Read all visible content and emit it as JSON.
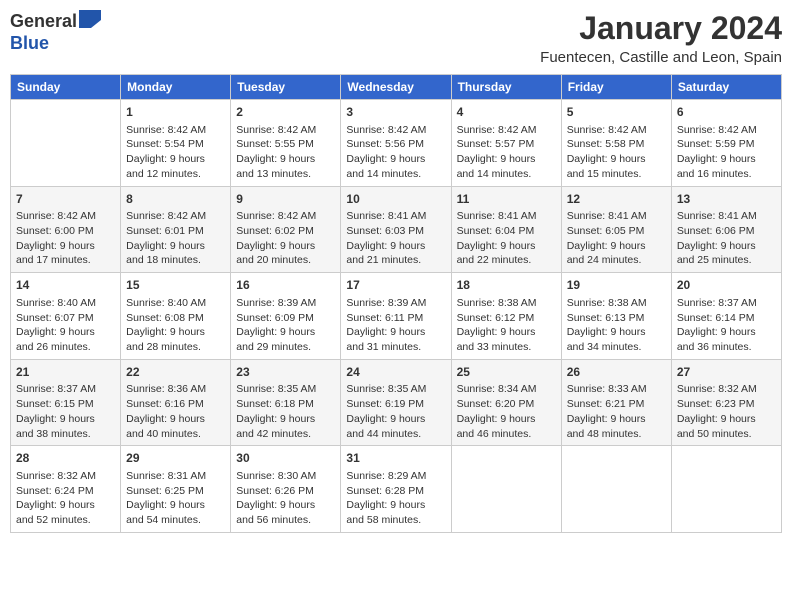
{
  "header": {
    "logo_general": "General",
    "logo_blue": "Blue",
    "month": "January 2024",
    "location": "Fuentecen, Castille and Leon, Spain"
  },
  "weekdays": [
    "Sunday",
    "Monday",
    "Tuesday",
    "Wednesday",
    "Thursday",
    "Friday",
    "Saturday"
  ],
  "weeks": [
    [
      {
        "day": "",
        "lines": []
      },
      {
        "day": "1",
        "lines": [
          "Sunrise: 8:42 AM",
          "Sunset: 5:54 PM",
          "Daylight: 9 hours",
          "and 12 minutes."
        ]
      },
      {
        "day": "2",
        "lines": [
          "Sunrise: 8:42 AM",
          "Sunset: 5:55 PM",
          "Daylight: 9 hours",
          "and 13 minutes."
        ]
      },
      {
        "day": "3",
        "lines": [
          "Sunrise: 8:42 AM",
          "Sunset: 5:56 PM",
          "Daylight: 9 hours",
          "and 14 minutes."
        ]
      },
      {
        "day": "4",
        "lines": [
          "Sunrise: 8:42 AM",
          "Sunset: 5:57 PM",
          "Daylight: 9 hours",
          "and 14 minutes."
        ]
      },
      {
        "day": "5",
        "lines": [
          "Sunrise: 8:42 AM",
          "Sunset: 5:58 PM",
          "Daylight: 9 hours",
          "and 15 minutes."
        ]
      },
      {
        "day": "6",
        "lines": [
          "Sunrise: 8:42 AM",
          "Sunset: 5:59 PM",
          "Daylight: 9 hours",
          "and 16 minutes."
        ]
      }
    ],
    [
      {
        "day": "7",
        "lines": [
          "Sunrise: 8:42 AM",
          "Sunset: 6:00 PM",
          "Daylight: 9 hours",
          "and 17 minutes."
        ]
      },
      {
        "day": "8",
        "lines": [
          "Sunrise: 8:42 AM",
          "Sunset: 6:01 PM",
          "Daylight: 9 hours",
          "and 18 minutes."
        ]
      },
      {
        "day": "9",
        "lines": [
          "Sunrise: 8:42 AM",
          "Sunset: 6:02 PM",
          "Daylight: 9 hours",
          "and 20 minutes."
        ]
      },
      {
        "day": "10",
        "lines": [
          "Sunrise: 8:41 AM",
          "Sunset: 6:03 PM",
          "Daylight: 9 hours",
          "and 21 minutes."
        ]
      },
      {
        "day": "11",
        "lines": [
          "Sunrise: 8:41 AM",
          "Sunset: 6:04 PM",
          "Daylight: 9 hours",
          "and 22 minutes."
        ]
      },
      {
        "day": "12",
        "lines": [
          "Sunrise: 8:41 AM",
          "Sunset: 6:05 PM",
          "Daylight: 9 hours",
          "and 24 minutes."
        ]
      },
      {
        "day": "13",
        "lines": [
          "Sunrise: 8:41 AM",
          "Sunset: 6:06 PM",
          "Daylight: 9 hours",
          "and 25 minutes."
        ]
      }
    ],
    [
      {
        "day": "14",
        "lines": [
          "Sunrise: 8:40 AM",
          "Sunset: 6:07 PM",
          "Daylight: 9 hours",
          "and 26 minutes."
        ]
      },
      {
        "day": "15",
        "lines": [
          "Sunrise: 8:40 AM",
          "Sunset: 6:08 PM",
          "Daylight: 9 hours",
          "and 28 minutes."
        ]
      },
      {
        "day": "16",
        "lines": [
          "Sunrise: 8:39 AM",
          "Sunset: 6:09 PM",
          "Daylight: 9 hours",
          "and 29 minutes."
        ]
      },
      {
        "day": "17",
        "lines": [
          "Sunrise: 8:39 AM",
          "Sunset: 6:11 PM",
          "Daylight: 9 hours",
          "and 31 minutes."
        ]
      },
      {
        "day": "18",
        "lines": [
          "Sunrise: 8:38 AM",
          "Sunset: 6:12 PM",
          "Daylight: 9 hours",
          "and 33 minutes."
        ]
      },
      {
        "day": "19",
        "lines": [
          "Sunrise: 8:38 AM",
          "Sunset: 6:13 PM",
          "Daylight: 9 hours",
          "and 34 minutes."
        ]
      },
      {
        "day": "20",
        "lines": [
          "Sunrise: 8:37 AM",
          "Sunset: 6:14 PM",
          "Daylight: 9 hours",
          "and 36 minutes."
        ]
      }
    ],
    [
      {
        "day": "21",
        "lines": [
          "Sunrise: 8:37 AM",
          "Sunset: 6:15 PM",
          "Daylight: 9 hours",
          "and 38 minutes."
        ]
      },
      {
        "day": "22",
        "lines": [
          "Sunrise: 8:36 AM",
          "Sunset: 6:16 PM",
          "Daylight: 9 hours",
          "and 40 minutes."
        ]
      },
      {
        "day": "23",
        "lines": [
          "Sunrise: 8:35 AM",
          "Sunset: 6:18 PM",
          "Daylight: 9 hours",
          "and 42 minutes."
        ]
      },
      {
        "day": "24",
        "lines": [
          "Sunrise: 8:35 AM",
          "Sunset: 6:19 PM",
          "Daylight: 9 hours",
          "and 44 minutes."
        ]
      },
      {
        "day": "25",
        "lines": [
          "Sunrise: 8:34 AM",
          "Sunset: 6:20 PM",
          "Daylight: 9 hours",
          "and 46 minutes."
        ]
      },
      {
        "day": "26",
        "lines": [
          "Sunrise: 8:33 AM",
          "Sunset: 6:21 PM",
          "Daylight: 9 hours",
          "and 48 minutes."
        ]
      },
      {
        "day": "27",
        "lines": [
          "Sunrise: 8:32 AM",
          "Sunset: 6:23 PM",
          "Daylight: 9 hours",
          "and 50 minutes."
        ]
      }
    ],
    [
      {
        "day": "28",
        "lines": [
          "Sunrise: 8:32 AM",
          "Sunset: 6:24 PM",
          "Daylight: 9 hours",
          "and 52 minutes."
        ]
      },
      {
        "day": "29",
        "lines": [
          "Sunrise: 8:31 AM",
          "Sunset: 6:25 PM",
          "Daylight: 9 hours",
          "and 54 minutes."
        ]
      },
      {
        "day": "30",
        "lines": [
          "Sunrise: 8:30 AM",
          "Sunset: 6:26 PM",
          "Daylight: 9 hours",
          "and 56 minutes."
        ]
      },
      {
        "day": "31",
        "lines": [
          "Sunrise: 8:29 AM",
          "Sunset: 6:28 PM",
          "Daylight: 9 hours",
          "and 58 minutes."
        ]
      },
      {
        "day": "",
        "lines": []
      },
      {
        "day": "",
        "lines": []
      },
      {
        "day": "",
        "lines": []
      }
    ]
  ]
}
